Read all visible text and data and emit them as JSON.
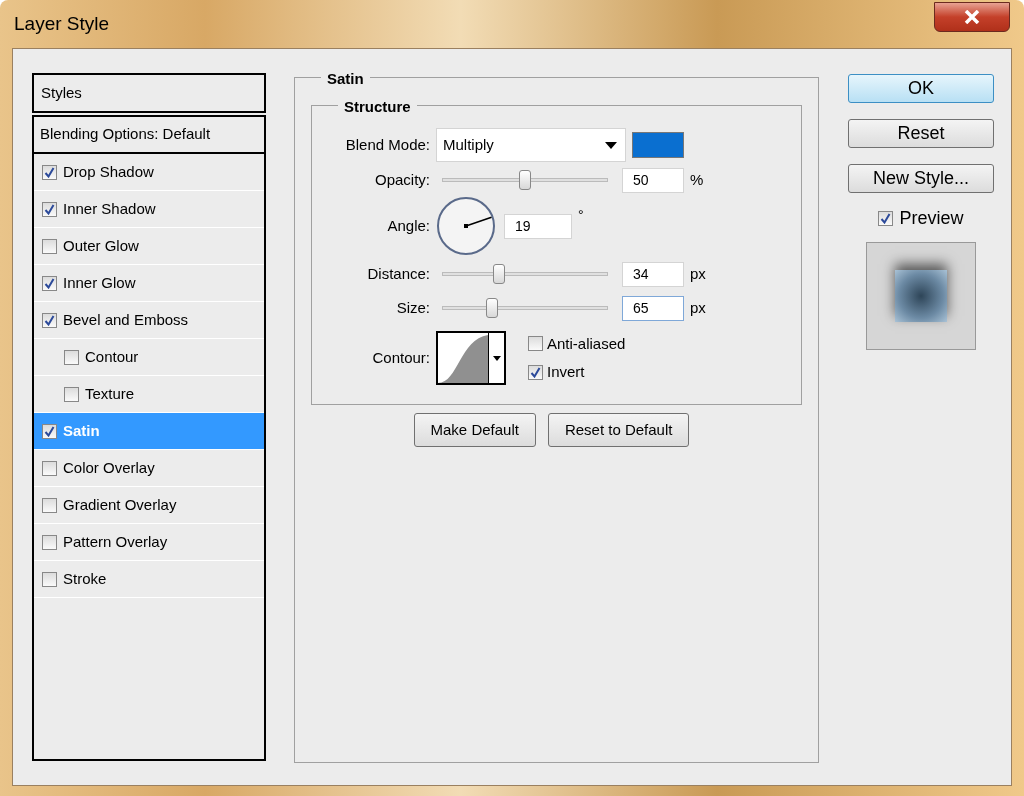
{
  "window": {
    "title": "Layer Style"
  },
  "sidebar": {
    "header": "Styles",
    "blending": {
      "label": "Blending Options: Default",
      "selected": false
    },
    "items": [
      {
        "label": "Drop Shadow",
        "checked": true,
        "selected": false
      },
      {
        "label": "Inner Shadow",
        "checked": true,
        "selected": false
      },
      {
        "label": "Outer Glow",
        "checked": false,
        "selected": false
      },
      {
        "label": "Inner Glow",
        "checked": true,
        "selected": false
      },
      {
        "label": "Bevel and Emboss",
        "checked": true,
        "selected": false,
        "children": [
          {
            "label": "Contour",
            "checked": false,
            "selected": false
          },
          {
            "label": "Texture",
            "checked": false,
            "selected": false
          }
        ]
      },
      {
        "label": "Satin",
        "checked": true,
        "selected": true
      },
      {
        "label": "Color Overlay",
        "checked": false,
        "selected": false
      },
      {
        "label": "Gradient Overlay",
        "checked": false,
        "selected": false
      },
      {
        "label": "Pattern Overlay",
        "checked": false,
        "selected": false
      },
      {
        "label": "Stroke",
        "checked": false,
        "selected": false
      }
    ]
  },
  "panel": {
    "title": "Satin",
    "group": "Structure",
    "blend_mode": {
      "label": "Blend Mode:",
      "value": "Multiply",
      "color": "#0a6fd0"
    },
    "opacity": {
      "label": "Opacity:",
      "level": 0.5,
      "value": "50",
      "unit": "%"
    },
    "angle": {
      "label": "Angle:",
      "value": "19",
      "unit": "°"
    },
    "distance": {
      "label": "Distance:",
      "level": 0.34,
      "value": "34",
      "unit": "px"
    },
    "size": {
      "label": "Size:",
      "level": 0.3,
      "value": "65",
      "unit": "px",
      "focused": true
    },
    "contour": {
      "label": "Contour:"
    },
    "anti_aliased": {
      "label": "Anti-aliased",
      "checked": false
    },
    "invert": {
      "label": "Invert",
      "checked": true
    },
    "buttons": [
      "Make Default",
      "Reset to Default"
    ]
  },
  "actions": [
    {
      "label": "OK",
      "default": true
    },
    {
      "label": "Reset",
      "default": false
    },
    {
      "label": "New Style...",
      "default": false
    }
  ],
  "preview": {
    "label": "Preview",
    "checked": true
  }
}
